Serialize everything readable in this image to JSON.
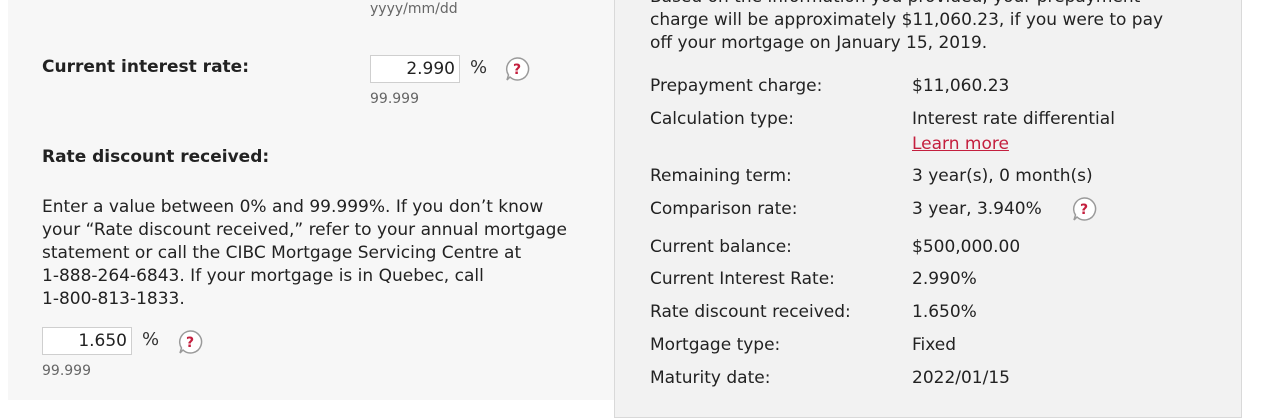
{
  "left": {
    "date_hint": "yyyy/mm/dd",
    "current_rate": {
      "label": "Current interest rate:",
      "value": "2.990",
      "unit": "%",
      "max_hint": "99.999"
    },
    "rate_discount": {
      "label": "Rate discount received:",
      "help_text": [
        "Enter a value between 0% and 99.999%. If you don’t know",
        "your “Rate discount received,” refer to your annual mortgage",
        "statement or call the CIBC Mortgage Servicing Centre at",
        "1-888-264-6843. If your mortgage is in Quebec, call",
        "1-800-813-1833."
      ],
      "value": "1.650",
      "unit": "%",
      "max_hint": "99.999"
    }
  },
  "right": {
    "summary_lines": [
      "Based on the information you provided, your prepayment",
      "charge will be approximately $11,060.23, if you were to pay",
      "off your mortgage on January 15, 2019."
    ],
    "rows": {
      "prepayment_charge": {
        "label": "Prepayment charge:",
        "value": "$11,060.23"
      },
      "calculation_type": {
        "label": "Calculation type:",
        "value": "Interest rate differential",
        "link": "Learn more"
      },
      "remaining_term": {
        "label": "Remaining term:",
        "value": "3 year(s), 0 month(s)"
      },
      "comparison_rate": {
        "label": "Comparison rate:",
        "value": "3 year, 3.940%"
      },
      "current_balance": {
        "label": "Current balance:",
        "value": "$500,000.00"
      },
      "current_interest_rate": {
        "label": "Current Interest Rate:",
        "value": "2.990%"
      },
      "rate_discount_received": {
        "label": "Rate discount received:",
        "value": "1.650%"
      },
      "mortgage_type": {
        "label": "Mortgage type:",
        "value": "Fixed"
      },
      "maturity_date": {
        "label": "Maturity date:",
        "value": "2022/01/15"
      }
    }
  },
  "colors": {
    "accent": "#c41f3e",
    "panel_bg": "#f2f2f2",
    "left_bg": "#f7f7f7"
  },
  "icons": {
    "help": "help-bubble-icon"
  }
}
